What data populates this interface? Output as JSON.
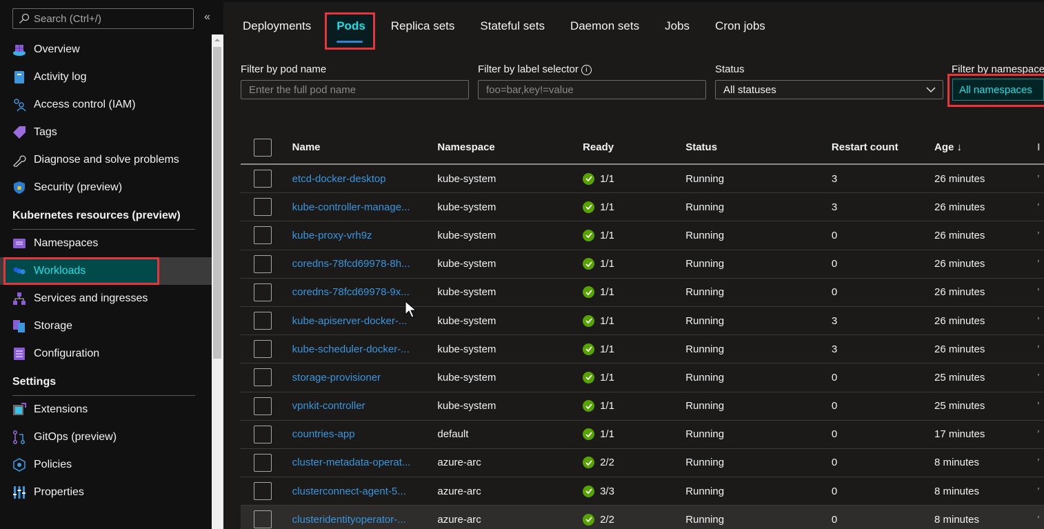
{
  "sidebar": {
    "search_placeholder": "Search (Ctrl+/)",
    "collapse_label": "«",
    "items_top": [
      {
        "label": "Overview",
        "icon": "overview-icon"
      },
      {
        "label": "Activity log",
        "icon": "activity-log-icon"
      },
      {
        "label": "Access control (IAM)",
        "icon": "access-control-icon"
      },
      {
        "label": "Tags",
        "icon": "tag-icon"
      },
      {
        "label": "Diagnose and solve problems",
        "icon": "wrench-icon"
      },
      {
        "label": "Security (preview)",
        "icon": "shield-icon"
      }
    ],
    "section_k8s": "Kubernetes resources (preview)",
    "items_k8s": [
      {
        "label": "Namespaces",
        "icon": "namespaces-icon"
      },
      {
        "label": "Workloads",
        "icon": "workloads-icon",
        "active": true
      },
      {
        "label": "Services and ingresses",
        "icon": "services-icon"
      },
      {
        "label": "Storage",
        "icon": "storage-icon"
      },
      {
        "label": "Configuration",
        "icon": "configuration-icon"
      }
    ],
    "section_settings": "Settings",
    "items_settings": [
      {
        "label": "Extensions",
        "icon": "extensions-icon"
      },
      {
        "label": "GitOps (preview)",
        "icon": "gitops-icon"
      },
      {
        "label": "Policies",
        "icon": "policies-icon"
      },
      {
        "label": "Properties",
        "icon": "properties-icon"
      }
    ]
  },
  "tabs": [
    {
      "label": "Deployments"
    },
    {
      "label": "Pods",
      "active": true
    },
    {
      "label": "Replica sets"
    },
    {
      "label": "Stateful sets"
    },
    {
      "label": "Daemon sets"
    },
    {
      "label": "Jobs"
    },
    {
      "label": "Cron jobs"
    }
  ],
  "filters": {
    "pod_name_label": "Filter by pod name",
    "pod_name_placeholder": "Enter the full pod name",
    "label_selector_label": "Filter by label selector",
    "label_selector_placeholder": "foo=bar,key!=value",
    "status_label": "Status",
    "status_value": "All statuses",
    "namespace_label": "Filter by namespace",
    "namespace_value": "All namespaces"
  },
  "table": {
    "columns": [
      "Name",
      "Namespace",
      "Ready",
      "Status",
      "Restart count",
      "Age ↓"
    ],
    "rows": [
      {
        "name": "etcd-docker-desktop",
        "namespace": "kube-system",
        "ready": "1/1",
        "status": "Running",
        "restarts": "3",
        "age": "26 minutes"
      },
      {
        "name": "kube-controller-manage...",
        "namespace": "kube-system",
        "ready": "1/1",
        "status": "Running",
        "restarts": "3",
        "age": "26 minutes"
      },
      {
        "name": "kube-proxy-vrh9z",
        "namespace": "kube-system",
        "ready": "1/1",
        "status": "Running",
        "restarts": "0",
        "age": "26 minutes"
      },
      {
        "name": "coredns-78fcd69978-8h...",
        "namespace": "kube-system",
        "ready": "1/1",
        "status": "Running",
        "restarts": "0",
        "age": "26 minutes"
      },
      {
        "name": "coredns-78fcd69978-9x...",
        "namespace": "kube-system",
        "ready": "1/1",
        "status": "Running",
        "restarts": "0",
        "age": "26 minutes"
      },
      {
        "name": "kube-apiserver-docker-...",
        "namespace": "kube-system",
        "ready": "1/1",
        "status": "Running",
        "restarts": "3",
        "age": "26 minutes"
      },
      {
        "name": "kube-scheduler-docker-...",
        "namespace": "kube-system",
        "ready": "1/1",
        "status": "Running",
        "restarts": "3",
        "age": "26 minutes"
      },
      {
        "name": "storage-provisioner",
        "namespace": "kube-system",
        "ready": "1/1",
        "status": "Running",
        "restarts": "0",
        "age": "25 minutes"
      },
      {
        "name": "vpnkit-controller",
        "namespace": "kube-system",
        "ready": "1/1",
        "status": "Running",
        "restarts": "0",
        "age": "25 minutes"
      },
      {
        "name": "countries-app",
        "namespace": "default",
        "ready": "1/1",
        "status": "Running",
        "restarts": "0",
        "age": "17 minutes"
      },
      {
        "name": "cluster-metadata-operat...",
        "namespace": "azure-arc",
        "ready": "2/2",
        "status": "Running",
        "restarts": "0",
        "age": "8 minutes"
      },
      {
        "name": "clusterconnect-agent-5...",
        "namespace": "azure-arc",
        "ready": "3/3",
        "status": "Running",
        "restarts": "0",
        "age": "8 minutes"
      },
      {
        "name": "clusteridentityoperator-...",
        "namespace": "azure-arc",
        "ready": "2/2",
        "status": "Running",
        "restarts": "0",
        "age": "8 minutes"
      }
    ]
  },
  "colors": {
    "accent": "#17e0e6",
    "link": "#3a96dd",
    "highlight_box": "#e8343b",
    "ready_ok": "#57a300"
  }
}
